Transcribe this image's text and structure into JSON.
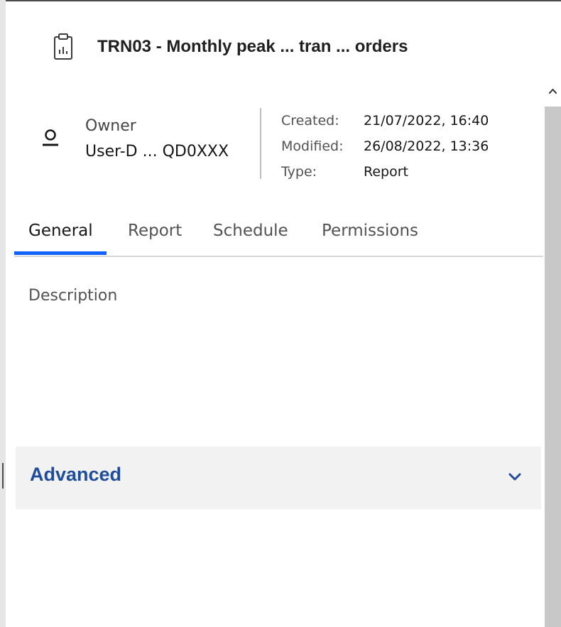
{
  "panel": {
    "title": "TRN03 - Monthly peak ... tran ... orders"
  },
  "owner": {
    "label": "Owner",
    "value": "User-D ... QD0XXX"
  },
  "meta": {
    "created_label": "Created:",
    "created_value": "21/07/2022, 16:40",
    "modified_label": "Modified:",
    "modified_value": "26/08/2022, 13:36",
    "type_label": "Type:",
    "type_value": "Report"
  },
  "tabs": [
    {
      "label": "General",
      "active": true
    },
    {
      "label": "Report",
      "active": false
    },
    {
      "label": "Schedule",
      "active": false
    },
    {
      "label": "Permissions",
      "active": false
    }
  ],
  "description": {
    "label": "Description"
  },
  "advanced": {
    "label": "Advanced",
    "icon": "chevron-down-icon"
  },
  "icons": {
    "report": "report-clipboard-icon",
    "owner": "user-icon",
    "scroll_up": "chevron-up-icon"
  },
  "colors": {
    "accent": "#0f62fe",
    "advanced_text": "#1f4d99",
    "scroll_track": "#c8c8c8"
  }
}
